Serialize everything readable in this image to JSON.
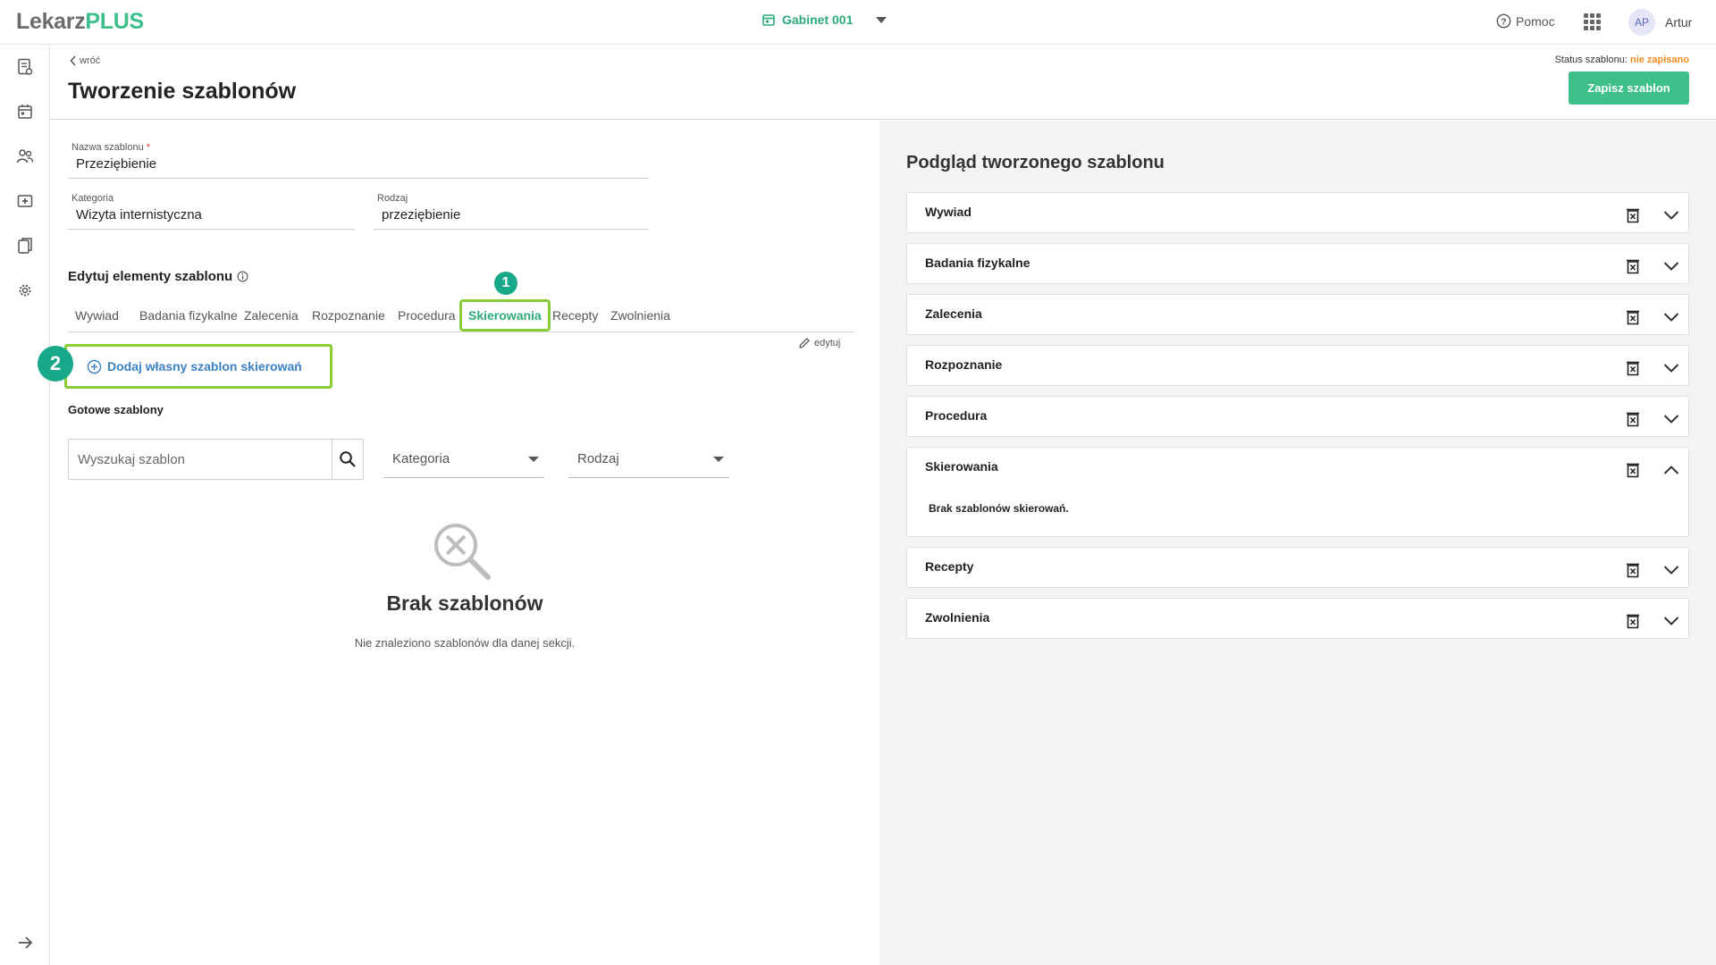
{
  "brand": {
    "part1": "Lekarz",
    "part2": "PLUS",
    "accent": "#3dbf8a"
  },
  "topbar": {
    "cabinet": "Gabinet 001",
    "help": "Pomoc",
    "avatar_initials": "AP",
    "username": "Artur"
  },
  "sidebar": {
    "icons": [
      "document-list-icon",
      "calendar-icon",
      "users-icon",
      "medical-kit-icon",
      "copy-icon",
      "gear-icon"
    ],
    "collapse_icon": "arrow-right-icon"
  },
  "header": {
    "back_label": "wróć",
    "title": "Tworzenie szablonów",
    "status_label": "Status szablonu:",
    "status_value": "nie zapisano",
    "save_label": "Zapisz szablon"
  },
  "form": {
    "name_label": "Nazwa szablonu",
    "name_required": "*",
    "name_value": "Przeziębienie",
    "category_label": "Kategoria",
    "category_value": "Wizyta internistyczna",
    "kind_label": "Rodzaj",
    "kind_value": "przeziębienie"
  },
  "editor": {
    "title": "Edytuj elementy szablonu",
    "tabs": [
      "Wywiad",
      "Badania fizykalne",
      "Zalecenia",
      "Rozpoznanie",
      "Procedura",
      "Skierowania",
      "Recepty",
      "Zwolnienia"
    ],
    "active_tab": "Skierowania",
    "edit_label": "edytuj",
    "add_own_label": "Dodaj własny szablon skierowań",
    "markers": [
      "1",
      "2"
    ]
  },
  "ready": {
    "title": "Gotowe szablony",
    "search_placeholder": "Wyszukaj szablon",
    "category_select": "Kategoria",
    "kind_select": "Rodzaj",
    "empty_title": "Brak szablonów",
    "empty_subtitle": "Nie znaleziono szablonów dla danej sekcji."
  },
  "preview": {
    "title": "Podgląd tworzonego szablonu",
    "sections": [
      {
        "title": "Wywiad",
        "expanded": false
      },
      {
        "title": "Badania fizykalne",
        "expanded": false
      },
      {
        "title": "Zalecenia",
        "expanded": false
      },
      {
        "title": "Rozpoznanie",
        "expanded": false
      },
      {
        "title": "Procedura",
        "expanded": false
      },
      {
        "title": "Skierowania",
        "expanded": true,
        "body": "Brak szablonów skierowań."
      },
      {
        "title": "Recepty",
        "expanded": false
      },
      {
        "title": "Zwolnienia",
        "expanded": false
      }
    ]
  }
}
